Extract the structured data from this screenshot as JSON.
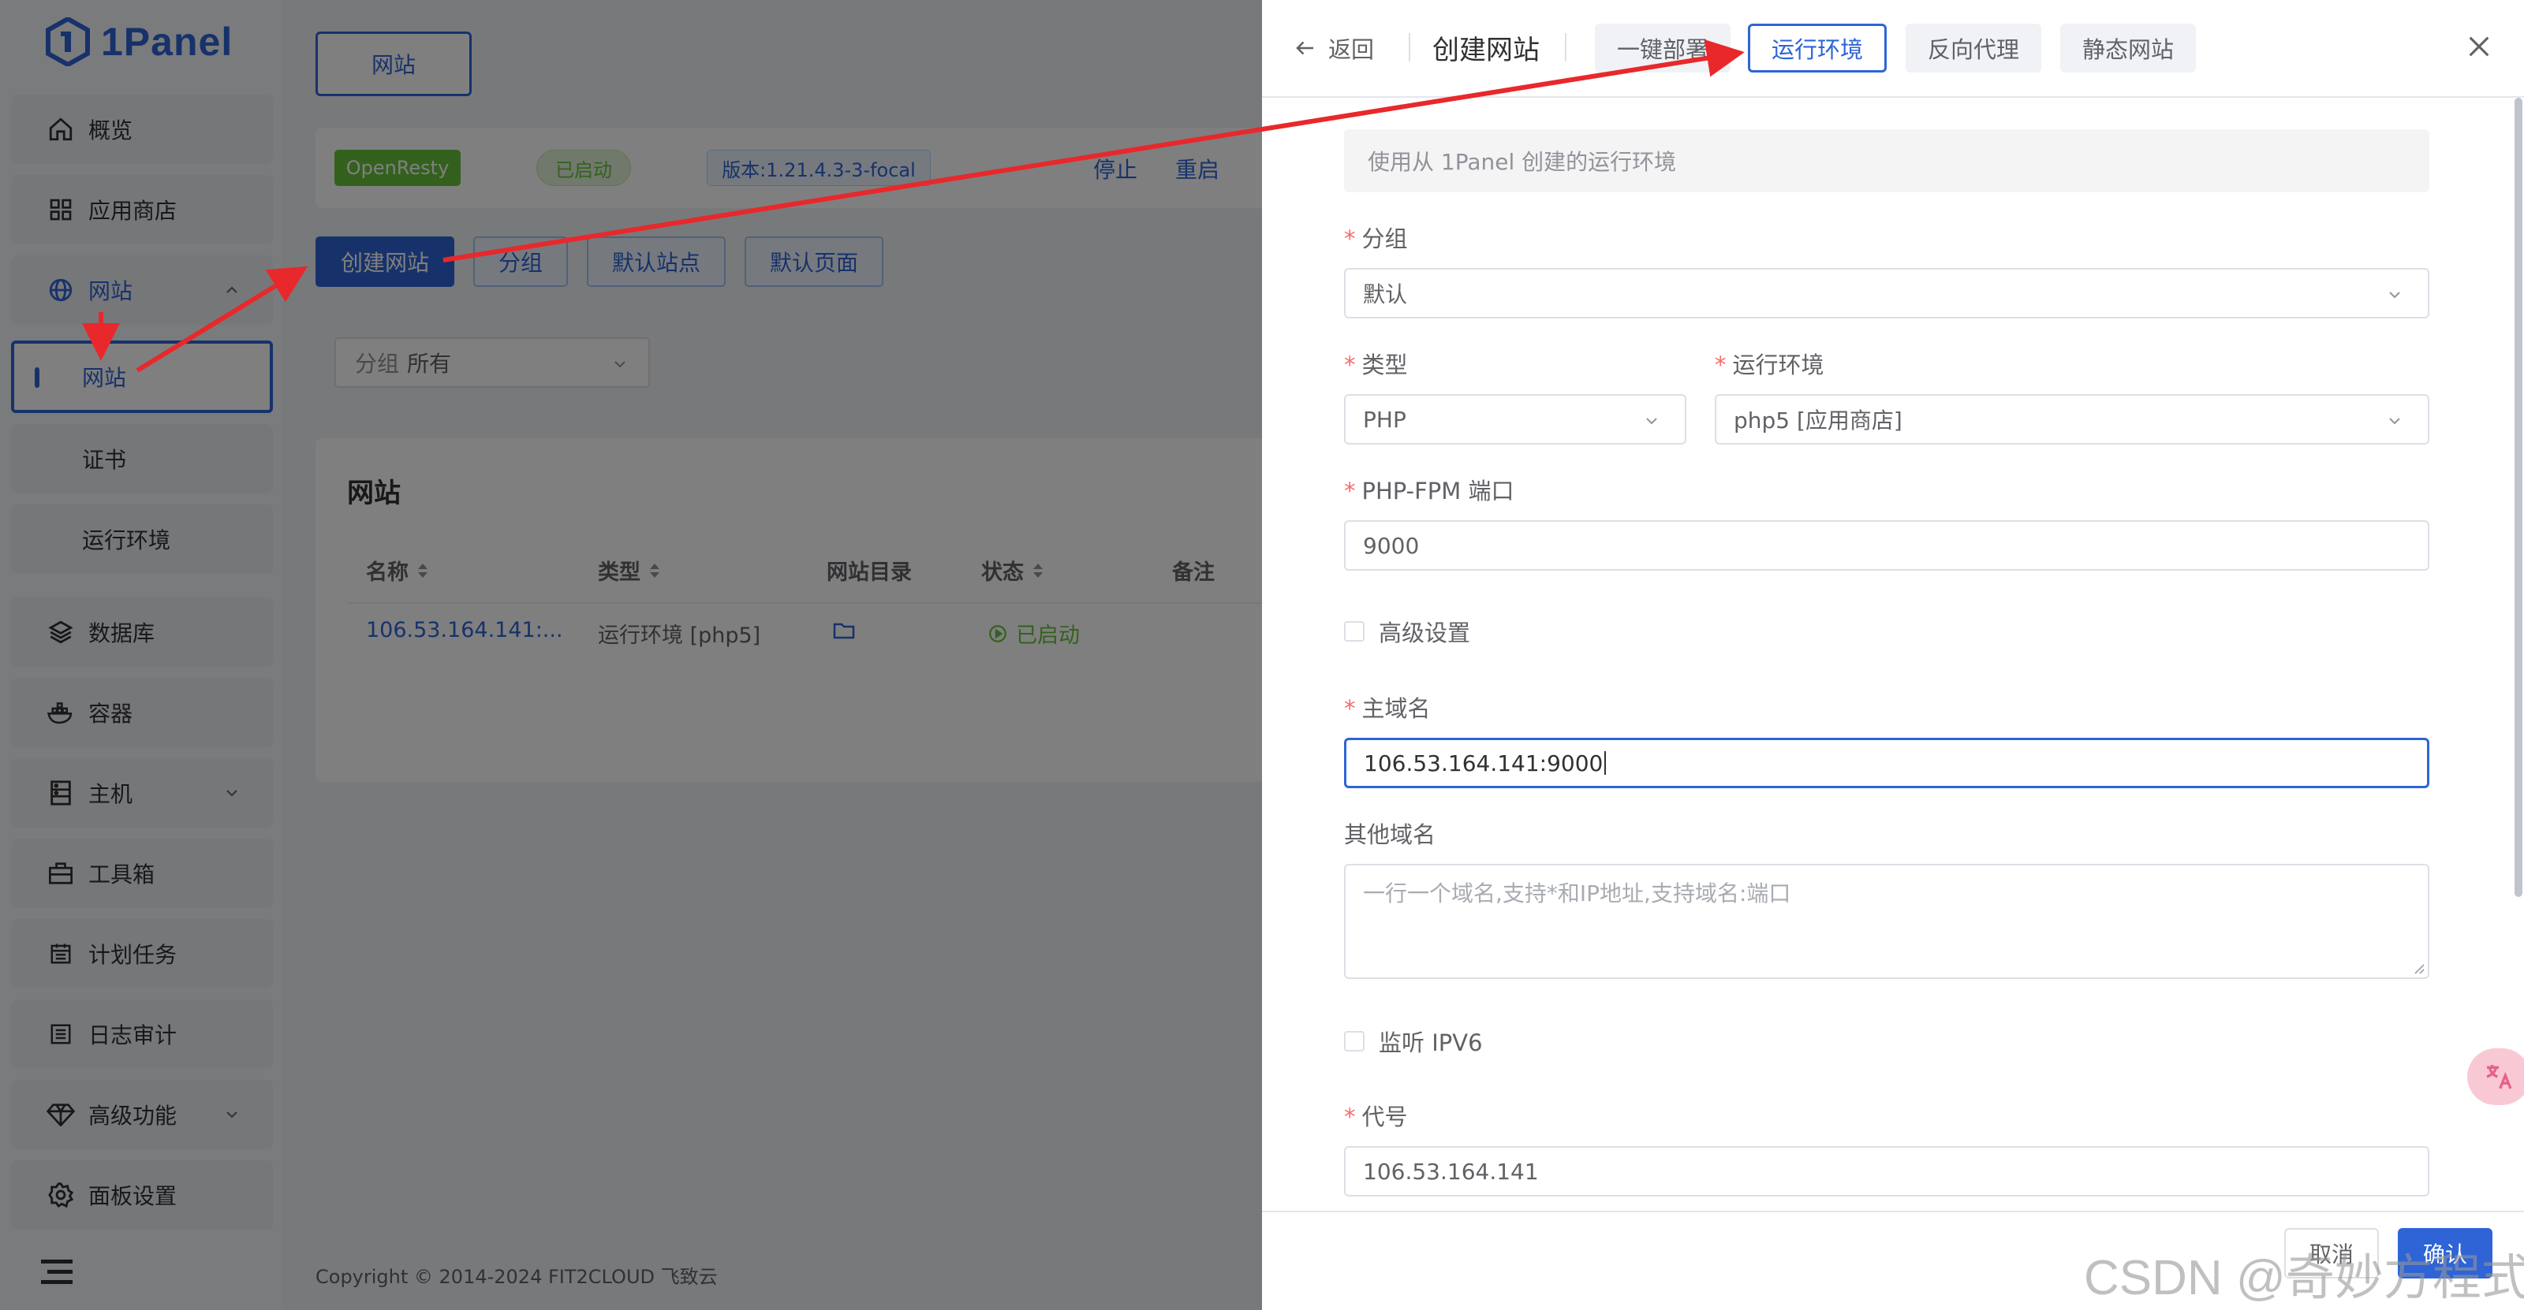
{
  "app": {
    "logo_text": "1Panel"
  },
  "sidebar": {
    "items": [
      {
        "label": "概览",
        "icon": "home-icon"
      },
      {
        "label": "应用商店",
        "icon": "grid-icon"
      },
      {
        "label": "网站",
        "icon": "globe-icon"
      },
      {
        "label": "数据库",
        "icon": "layers-icon"
      },
      {
        "label": "容器",
        "icon": "docker-icon"
      },
      {
        "label": "主机",
        "icon": "server-icon"
      },
      {
        "label": "工具箱",
        "icon": "toolbox-icon"
      },
      {
        "label": "计划任务",
        "icon": "calendar-icon"
      },
      {
        "label": "日志审计",
        "icon": "list-icon"
      },
      {
        "label": "高级功能",
        "icon": "diamond-icon"
      },
      {
        "label": "面板设置",
        "icon": "gear-icon"
      }
    ],
    "website_sub": [
      "网站",
      "证书",
      "运行环境"
    ]
  },
  "main": {
    "top_tab": "网站",
    "status": {
      "app": "OpenResty",
      "state": "已启动",
      "version": "版本:1.21.4.3-3-focal",
      "stop": "停止",
      "restart": "重启"
    },
    "buttons": {
      "create": "创建网站",
      "group": "分组",
      "default_site": "默认站点",
      "default_page": "默认页面"
    },
    "filter": {
      "label": "分组",
      "value": "所有"
    },
    "table": {
      "title": "网站",
      "headers": [
        "名称",
        "类型",
        "网站目录",
        "状态",
        "备注"
      ],
      "rows": [
        {
          "name": "106.53.164.141:...",
          "type": "运行环境 [php5]",
          "status": "已启动"
        }
      ]
    },
    "footer": "Copyright © 2014-2024 FIT2CLOUD 飞致云"
  },
  "drawer": {
    "back": "返回",
    "title": "创建网站",
    "tabs": [
      "一键部署",
      "运行环境",
      "反向代理",
      "静态网站"
    ],
    "active_tab": 1,
    "info": "使用从 1Panel 创建的运行环境",
    "form": {
      "group_label": "分组",
      "group_value": "默认",
      "type_label": "类型",
      "type_value": "PHP",
      "runtime_label": "运行环境",
      "runtime_value": "php5 [应用商店]",
      "port_label": "PHP-FPM 端口",
      "port_value": "9000",
      "advanced_label": "高级设置",
      "domain_label": "主域名",
      "domain_value": "106.53.164.141:9000",
      "other_domain_label": "其他域名",
      "other_domain_placeholder": "一行一个域名,支持*和IP地址,支持域名:端口",
      "ipv6_label": "监听 IPV6",
      "alias_label": "代号",
      "alias_value": "106.53.164.141"
    },
    "buttons": {
      "cancel": "取消",
      "confirm": "确认"
    }
  },
  "watermark": "CSDN @奇妙方程式",
  "colors": {
    "primary": "#2e64d6",
    "success": "#67c23a",
    "required": "#f56c6c",
    "annotation": "#e8282b"
  }
}
